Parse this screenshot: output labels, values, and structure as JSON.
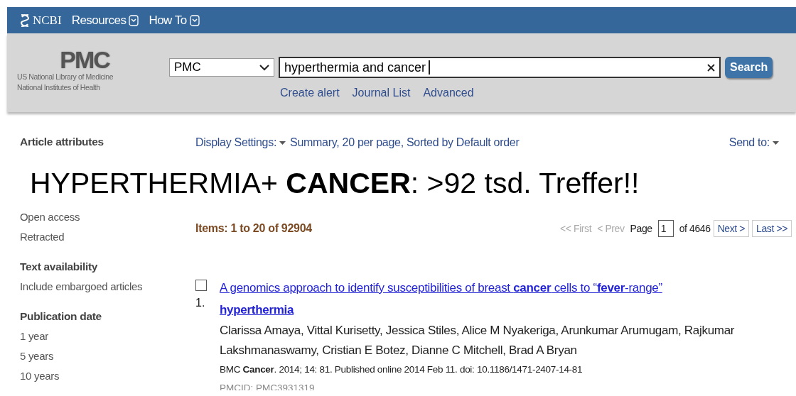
{
  "topbar": {
    "brand": "NCBI",
    "menus": [
      {
        "label": "Resources"
      },
      {
        "label": "How To"
      }
    ]
  },
  "header": {
    "logo": "PMC",
    "org_lines": [
      "US National Library of Medicine",
      "National Institutes of Health"
    ],
    "database": "PMC",
    "query": "hyperthermia and cancer",
    "search_button": "Search",
    "links": [
      "Create alert",
      "Journal List",
      "Advanced"
    ]
  },
  "sidebar": {
    "top_group": {
      "title": "Article attributes"
    },
    "items_after_banner": [
      "Open access",
      "Retracted"
    ],
    "groups": [
      {
        "title": "Text availability",
        "items": [
          "Include embargoed articles"
        ]
      },
      {
        "title": "Publication date",
        "items": [
          "1 year",
          "5 years",
          "10 years"
        ]
      }
    ]
  },
  "display_bar": {
    "label": "Display Settings:",
    "value": "Summary, 20 per page, Sorted by Default order",
    "send_to": "Send to:"
  },
  "overlay": "HYPERTHERMIA+ **CANCER**: >92 tsd. Treffer!!",
  "results": {
    "summary": "Items: 1 to 20 of 92904",
    "pager": {
      "links": [
        {
          "label": "<< First",
          "disabled": true
        },
        {
          "label": "< Prev",
          "disabled": true
        }
      ],
      "page_label": "Page",
      "page": "1",
      "of": "of 4646",
      "buttons": [
        {
          "label": "Next >",
          "disabled": false
        },
        {
          "label": "Last >>",
          "disabled": false
        }
      ]
    },
    "items": [
      {
        "number": "1.",
        "checked": false,
        "title": "A genomics approach to identify susceptibilities of breast **cancer** cells to “**fever**-range” **hyperthermia**",
        "authors": "Clarissa Amaya, Vittal Kurisetty, Jessica Stiles, Alice M Nyakeriga, Arunkumar Arumugam, Rajkumar Lakshmanaswamy, Cristian E Botez, Dianne C Mitchell, Brad A Bryan",
        "citation": "BMC **Cancer**. 2014; 14: 81. Published online 2014 Feb 11. doi: 10.1186/1471-2407-14-81",
        "pmcid": "PMCID: PMC3931319"
      }
    ]
  }
}
